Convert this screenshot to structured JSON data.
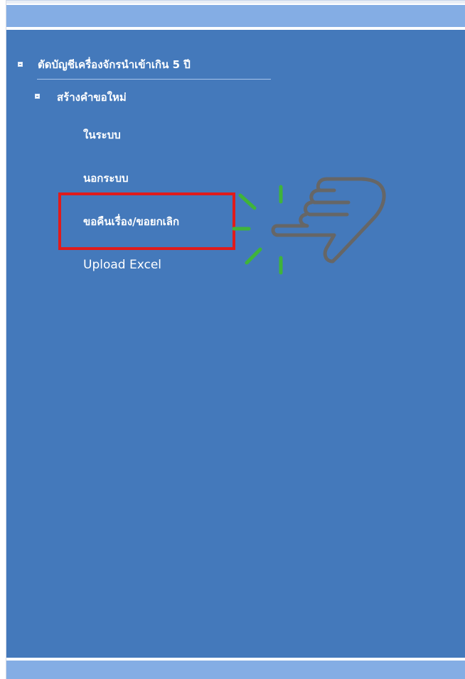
{
  "tree": {
    "root": {
      "label": "ตัดบัญชีเครื่องจักรนำเข้าเกิน 5 ปี"
    },
    "group": {
      "label": "สร้างคำขอใหม่"
    },
    "items": [
      {
        "label": "ในระบบ"
      },
      {
        "label": "นอกระบบ"
      },
      {
        "label": "ขอคืนเรื่อง/ขอยกเลิก",
        "highlighted": true
      },
      {
        "label": "Upload Excel"
      }
    ]
  },
  "colors": {
    "panel": "#4479bb",
    "header": "#84ade4",
    "highlight": "#e01b1b",
    "sparkle": "#3fb43a",
    "hand": "#666666"
  },
  "icons": {
    "pointer": "pointing-hand-icon",
    "toggle": "tree-collapse-icon"
  }
}
